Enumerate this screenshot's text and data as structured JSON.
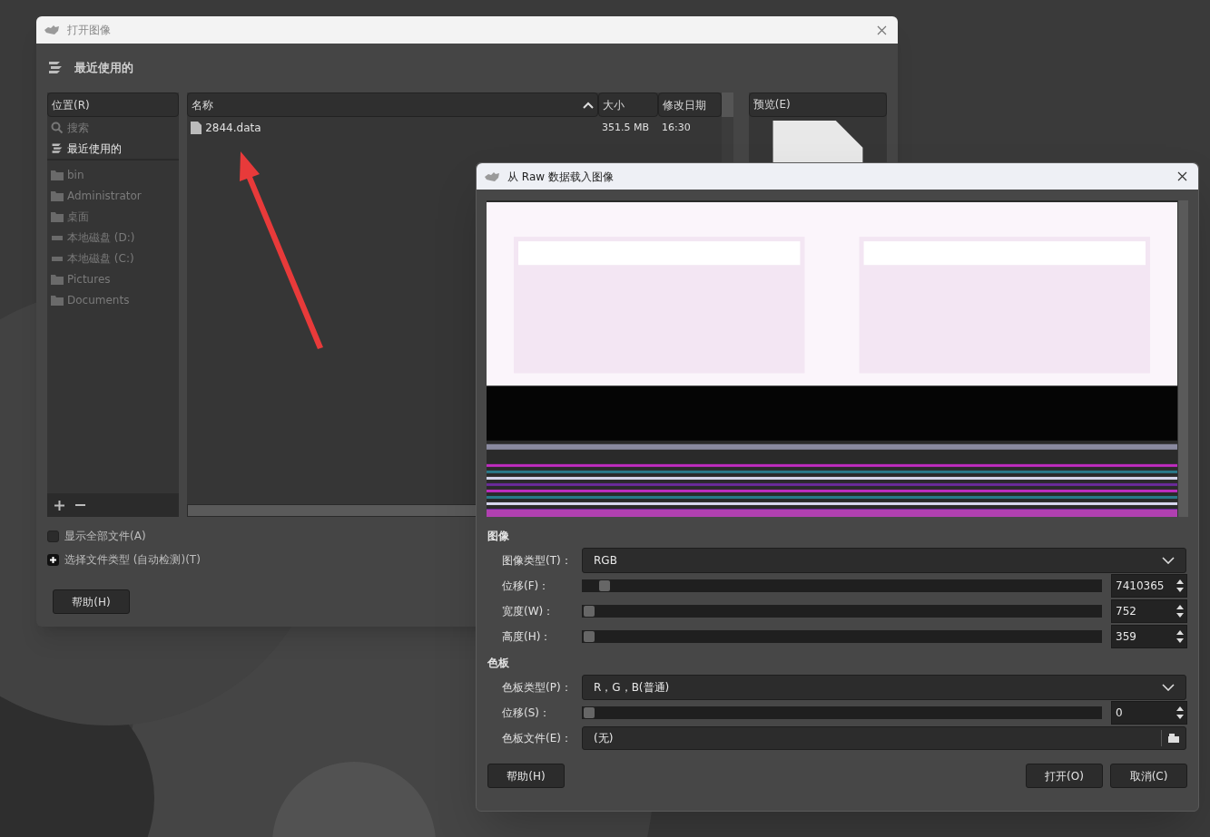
{
  "open_dialog": {
    "title": "打开图像",
    "location_title": "最近使用的",
    "places_header": "位置(R)",
    "places": [
      {
        "label": "搜索",
        "kind": "search",
        "disabled": true
      },
      {
        "label": "最近使用的",
        "kind": "recent",
        "disabled": false
      },
      {
        "label": "bin",
        "kind": "folder",
        "disabled": true
      },
      {
        "label": "Administrator",
        "kind": "folder",
        "disabled": true
      },
      {
        "label": "桌面",
        "kind": "folder",
        "disabled": true
      },
      {
        "label": "本地磁盘 (D:)",
        "kind": "drive",
        "disabled": true
      },
      {
        "label": "本地磁盘 (C:)",
        "kind": "drive",
        "disabled": true
      },
      {
        "label": "Pictures",
        "kind": "folder",
        "disabled": true
      },
      {
        "label": "Documents",
        "kind": "folder",
        "disabled": true
      }
    ],
    "columns": [
      {
        "label": "名称",
        "sorted": true
      },
      {
        "label": "大小",
        "sorted": false
      },
      {
        "label": "修改日期",
        "sorted": false
      }
    ],
    "files": [
      {
        "name": "2844.data",
        "size": "351.5 MB",
        "modified": "16:30"
      }
    ],
    "preview_label": "预览(E)",
    "options": [
      {
        "kind": "checkbox",
        "label": "显示全部文件(A)",
        "checked": false
      },
      {
        "kind": "expander",
        "label": "选择文件类型 (自动检测)(T)",
        "expanded": false
      }
    ],
    "help_button": "帮助(H)"
  },
  "raw_dialog": {
    "title": "从 Raw 数据载入图像",
    "sections": [
      {
        "title": "图像",
        "rows": [
          {
            "kind": "dropdown",
            "label": "图像类型(T)：",
            "value": "RGB"
          },
          {
            "kind": "slider",
            "label": "位移(F)：",
            "value": "7410365",
            "level": 0.03
          },
          {
            "kind": "slider",
            "label": "宽度(W)：",
            "value": "752",
            "level": 0.0
          },
          {
            "kind": "slider",
            "label": "高度(H)：",
            "value": "359",
            "level": 0.0
          }
        ]
      },
      {
        "title": "色板",
        "rows": [
          {
            "kind": "dropdown",
            "label": "色板类型(P)：",
            "value": "R，G，B(普通)"
          },
          {
            "kind": "slider",
            "label": "位移(S)：",
            "value": "0",
            "level": 0.0
          },
          {
            "kind": "file",
            "label": "色板文件(E)：",
            "value": "(无)"
          }
        ]
      }
    ],
    "buttons": [
      {
        "label": "帮助(H)"
      },
      {
        "label": "打开(O)"
      },
      {
        "label": "取消(C)"
      }
    ]
  }
}
